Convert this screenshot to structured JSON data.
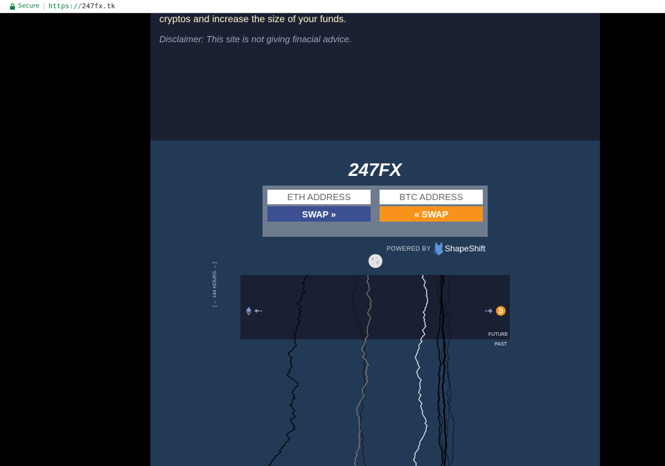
{
  "browser": {
    "secure_label": "Secure",
    "url_scheme": "https://",
    "url_host": "247fx.tk"
  },
  "top": {
    "text": "cryptos and increase the size of your funds.",
    "disclaimer": "Disclaimer: This site is not giving finacial advice."
  },
  "swap": {
    "title": "247FX",
    "eth_placeholder": "ETH ADDRESS",
    "btc_placeholder": "BTC ADDRESS",
    "eth_button": "SWAP »",
    "btc_button": "« SWAP",
    "powered_by": "POWERED BY",
    "shapeshift": "ShapeShift"
  },
  "chart": {
    "future_label": "FUTURE",
    "past_label": "PAST",
    "time_label": "[ ← 144 HOURS → ]",
    "left_icon": "eth-icon",
    "right_icon": "btc-icon",
    "colors": {
      "eth": "#7d8bb5",
      "btc": "#f7931a",
      "band": "#192033",
      "bg": "#233a56"
    }
  }
}
